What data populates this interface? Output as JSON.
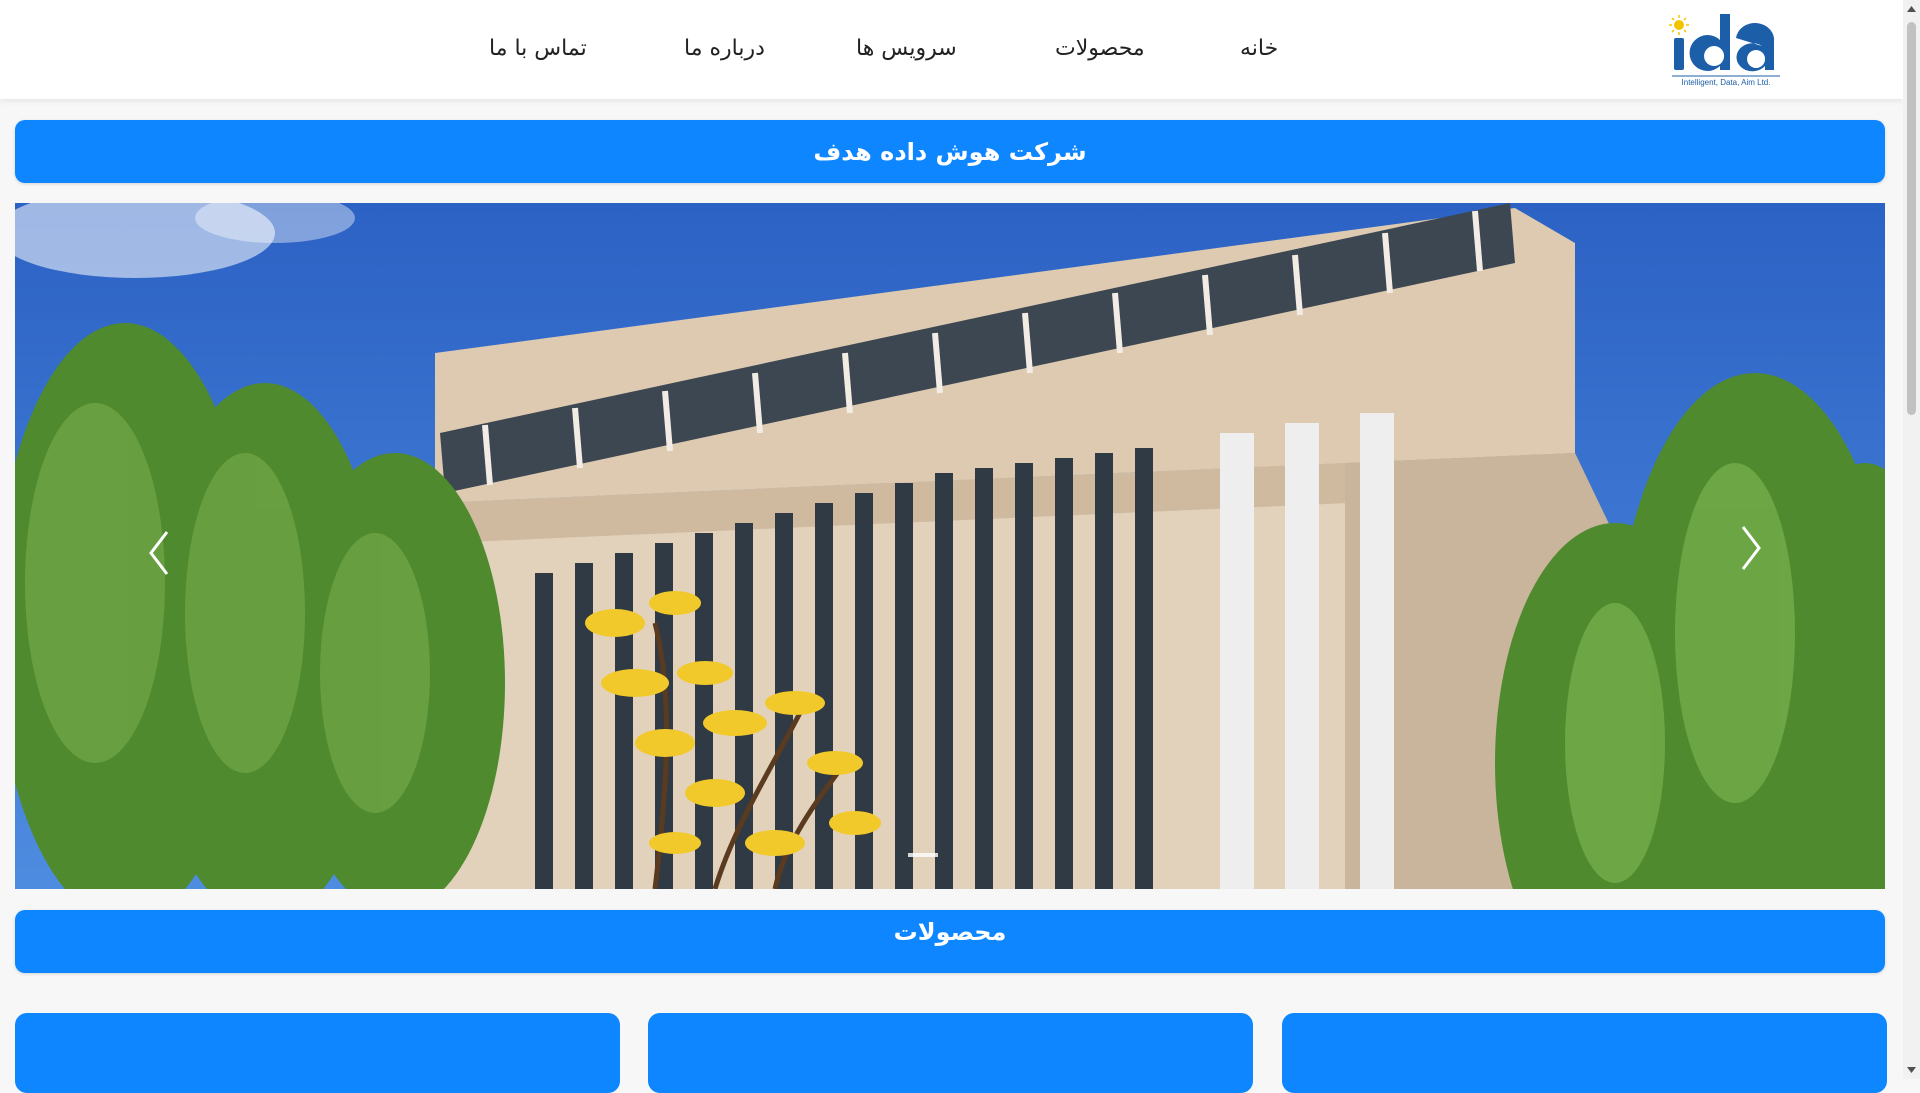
{
  "header": {
    "logo": {
      "text": "ida",
      "tagline": "Intelligent, Data, Aim Ltd.",
      "brand_color": "#1c5fa8",
      "accent_color": "#f2c400"
    },
    "nav": [
      {
        "label": "خانه"
      },
      {
        "label": "محصولات"
      },
      {
        "label": "سرویس ها"
      },
      {
        "label": "درباره ما"
      },
      {
        "label": "تماس با ما"
      }
    ]
  },
  "hero": {
    "title": "شرکت هوش داده هدف",
    "carousel": {
      "image": "building-with-trees",
      "prev_icon": "chevron-left-icon",
      "next_icon": "chevron-right-icon"
    }
  },
  "products": {
    "title": "محصولات"
  },
  "colors": {
    "primary": "#0d86ff",
    "background": "#f7f7f7"
  }
}
